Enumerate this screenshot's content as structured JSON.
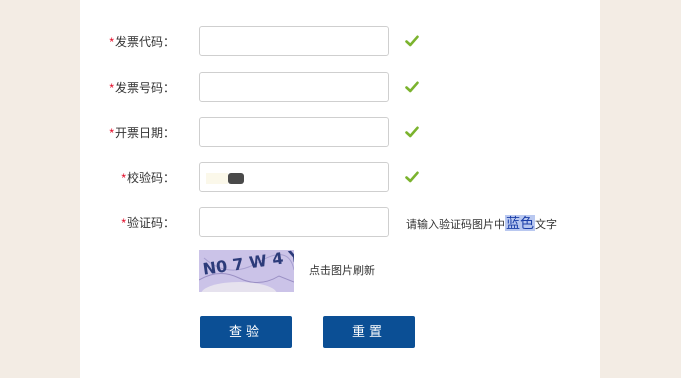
{
  "form": {
    "required_mark": "*",
    "fields": [
      {
        "label": "发票代码：",
        "value": ""
      },
      {
        "label": "发票号码：",
        "value": ""
      },
      {
        "label": "开票日期：",
        "value": ""
      },
      {
        "label": "校验码：",
        "value": ""
      },
      {
        "label": "验证码：",
        "value": ""
      }
    ],
    "hint_prefix": "请输入验证码图片中",
    "hint_highlight": "蓝色",
    "hint_suffix": "文字",
    "captcha_text": "N0 7 W 4 Y",
    "refresh_text": "点击图片刷新",
    "query_button": "查验",
    "reset_button": "重置"
  },
  "colors": {
    "background": "#f3ece4",
    "required": "#e1001e",
    "button": "#0b4f95",
    "check": "#7bb32e",
    "highlight_text": "#1b3ea7",
    "highlight_bg": "#b9c8f0"
  },
  "icons": {
    "check": "check-mark-icon"
  }
}
